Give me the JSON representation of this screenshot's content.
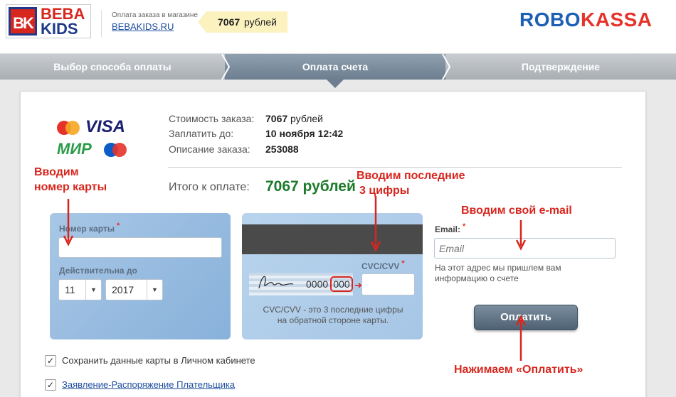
{
  "header": {
    "logo_mark": "BK",
    "logo_word1": "BEBA",
    "logo_word2": "KIDS",
    "shop_label": "Оплата заказа в магазине",
    "shop_link": "BEBAKIDS.RU",
    "price_value": "7067",
    "price_unit": "рублей",
    "brand_part1": "ROBO",
    "brand_part2": "KASSA"
  },
  "steps": [
    "Выбор способа оплаты",
    "Оплата счета",
    "Подтверждение"
  ],
  "card_brands": {
    "visa": "VISA",
    "mir": "МИР"
  },
  "order": {
    "rows": [
      {
        "label": "Стоимость заказа:",
        "value_bold": "7067",
        "value_rest": " рублей"
      },
      {
        "label": "Заплатить до:",
        "value_bold": "10 ноября 12:42",
        "value_rest": ""
      },
      {
        "label": "Описание заказа:",
        "value_bold": "253088",
        "value_rest": ""
      }
    ],
    "total_label": "Итого к оплате:",
    "total_value": "7067 рублей"
  },
  "card_front": {
    "number_label": "Номер карты",
    "number_value": "",
    "expiry_label": "Действительна до",
    "month": "11",
    "year": "2017"
  },
  "card_back": {
    "digits": "0000",
    "cvv_digits": "000",
    "cvv_label": "CVC/CVV",
    "cvv_value": "",
    "help_line1": "CVC/CVV - это 3 последние цифры",
    "help_line2": "на обратной стороне карты."
  },
  "email": {
    "label": "Email:",
    "placeholder": "Email",
    "help": "На этот адрес мы пришлем вам информацию о счете"
  },
  "pay_button": "Оплатить",
  "checkboxes": [
    {
      "label": "Сохранить данные карты в Личном кабинете",
      "checked": true,
      "link": false
    },
    {
      "label": "Заявление-Распоряжение Плательщика",
      "checked": true,
      "link": true
    }
  ],
  "required_mark": "*",
  "annotations": {
    "card_number_line1": "Вводим",
    "card_number_line2": "номер карты",
    "cvv_line1": "Вводим последние",
    "cvv_line2": "3 цифры",
    "email": "Вводим свой e-mail",
    "pay": "Нажимаем «Оплатить»"
  },
  "colors": {
    "accent_red": "#d7261e",
    "brand_blue": "#1d5fb5",
    "total_green": "#1c7a2a"
  }
}
